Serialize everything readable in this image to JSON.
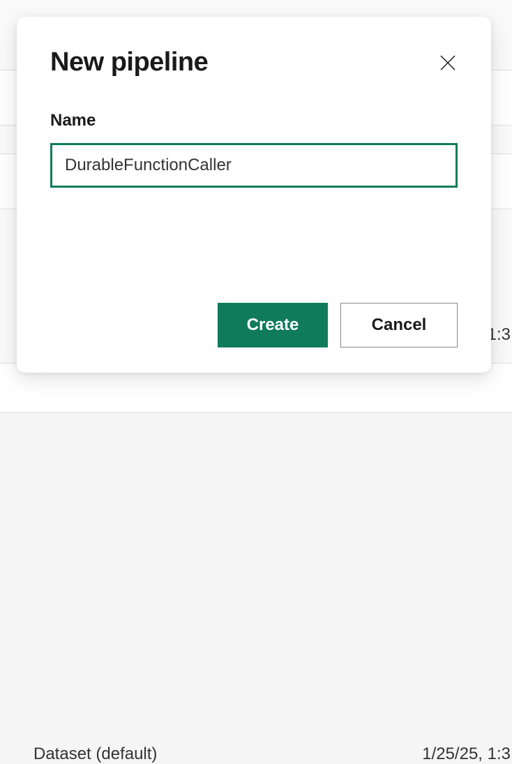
{
  "modal": {
    "title": "New pipeline",
    "name_label": "Name",
    "name_value": "DurableFunctionCaller",
    "create_label": "Create",
    "cancel_label": "Cancel"
  },
  "background": {
    "timestamp_fragment_1": "1:3",
    "row_label": "Dataset (default)",
    "timestamp_fragment_2": "1/25/25, 1:3"
  }
}
